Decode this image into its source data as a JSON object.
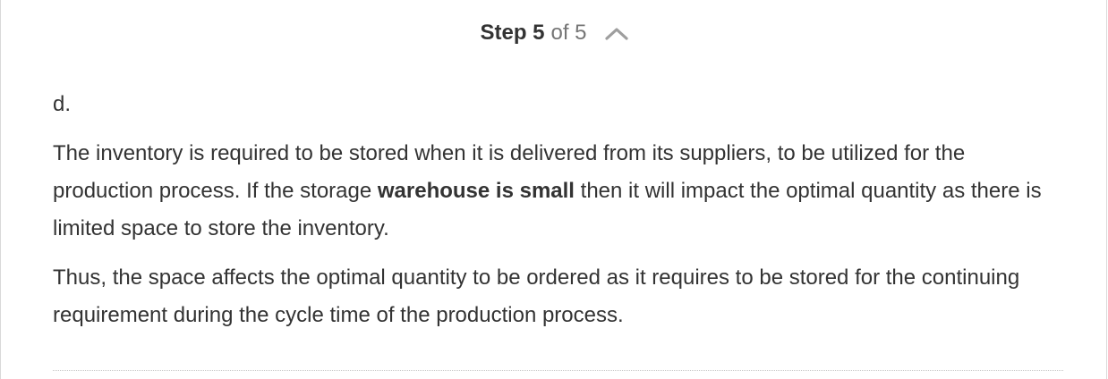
{
  "step": {
    "label": "Step 5",
    "of": "of 5",
    "toggle_icon": "chevron-up-icon"
  },
  "solution": {
    "part_label": "d.",
    "para1": {
      "before": "The inventory is required to be stored when it is delivered from its suppliers, to be utilized for the production process. If the storage ",
      "bold": "warehouse is small",
      "after": " then it will impact the optimal quantity as there is limited space to store the inventory."
    },
    "para2": "Thus, the space affects the optimal quantity to be ordered as it requires to be stored for the continuing requirement during the cycle time of the production process."
  },
  "colors": {
    "text": "#333333",
    "muted": "#757575",
    "icon": "#9e9e9e"
  }
}
